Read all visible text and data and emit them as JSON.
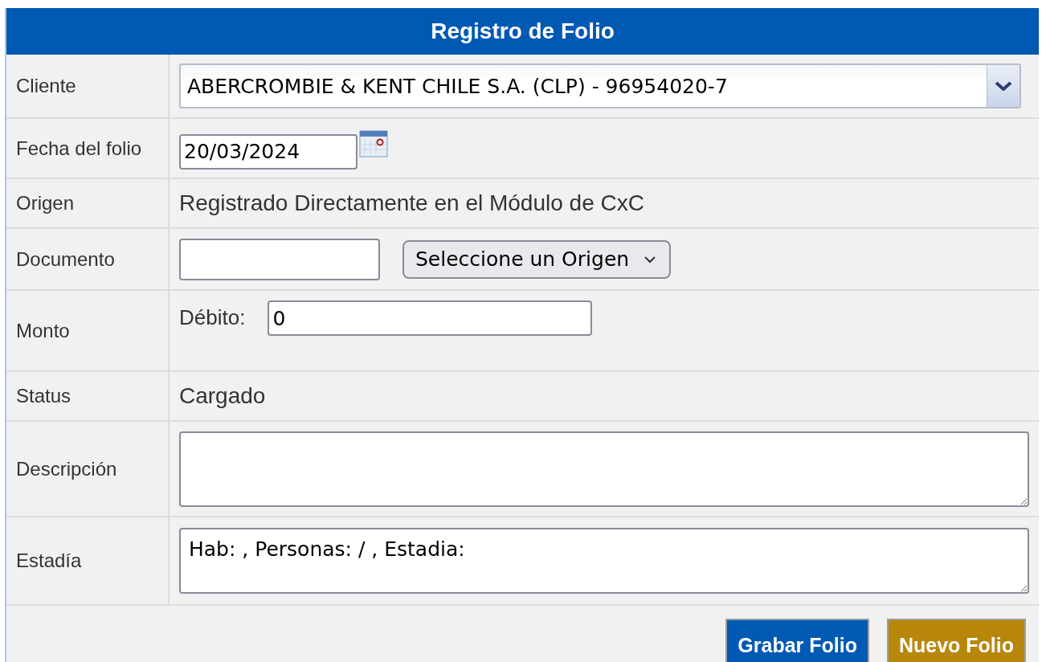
{
  "title": "Registro de Folio",
  "rows": [
    {
      "kind": "select",
      "label": "Cliente",
      "value": "ABERCROMBIE & KENT CHILE S.A. (CLP) - 96954020-7"
    },
    {
      "kind": "date",
      "label": "Fecha del folio",
      "value": "20/03/2024"
    },
    {
      "kind": "text",
      "label": "Origen",
      "value": "Registrado Directamente en el Módulo de CxC"
    },
    {
      "kind": "document",
      "label": "Documento",
      "select": "Seleccione un Origen"
    },
    {
      "kind": "amount",
      "label": "Monto",
      "field_label": "Débito:",
      "value": "0"
    },
    {
      "kind": "text",
      "label": "Status",
      "value": "Cargado"
    },
    {
      "kind": "textarea",
      "label": "Descripción"
    },
    {
      "kind": "textarea",
      "label": "Estadía",
      "value": "Hab: , Personas: / , Estadia:"
    }
  ],
  "buttons": [
    {
      "label": "Grabar Folio",
      "kind": "primary"
    },
    {
      "label": "Nuevo Folio",
      "kind": "secondary"
    }
  ]
}
